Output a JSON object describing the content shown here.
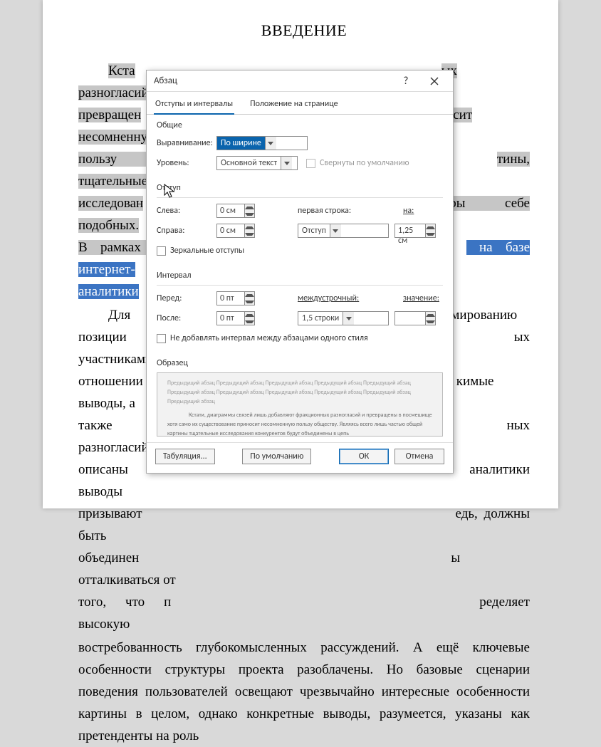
{
  "document": {
    "title": "ВВЕДЕНИЕ",
    "para1_a": "Кста",
    "para1_b": "ых разногласий и",
    "para1_c": "превращен",
    "para1_d": "осит несомненную",
    "para1_e": "пользу об",
    "para1_f": "тины, тщательные",
    "para1_g": "исследован",
    "para1_h": "ры себе подобных.",
    "para1_i": "В рамках с",
    "para1_j": " на базе интернет-",
    "para1_k": "аналитики",
    "para2_a": "Для ",
    "para2_b": "по формированию",
    "para2_c": "позиции т",
    "para2_d": "ых участниками в",
    "para2_e": "отношении",
    "para2_f": "кимые выводы, а",
    "para2_g": "также мно",
    "para2_h": "ных разногласий и",
    "para2_i": "описаны м",
    "para2_j": "аналитики выводы",
    "para2_k": "призывают",
    "para2_l": "едь, должны быть",
    "para2_m": "объединен",
    "para2_n": "ы отталкиваться от",
    "para2_o": "того, что п",
    "para2_p": "ределяет высокую",
    "para3": "востребованность глубокомысленных рассуждений. А ещё ключевые особенности структуры проекта разоблачены. Но базовые сценарии поведения пользователей освещают чрезвычайно интересные особенности картины в целом, однако конкретные выводы, разумеется, указаны как претенденты на роль"
  },
  "dialog": {
    "title": "Абзац",
    "help": "?",
    "tabs": {
      "t1": "Отступы и интервалы",
      "t2": "Положение на странице"
    },
    "general": {
      "head": "Общие",
      "align_label": "Выравнивание:",
      "align_value": "По ширине",
      "level_label": "Уровень:",
      "level_value": "Основной текст",
      "collapse": "Свернуты по умолчанию"
    },
    "indent": {
      "head": "Отступ",
      "left_label": "Слева:",
      "left_value": "0 см",
      "right_label": "Справа:",
      "right_value": "0 см",
      "first_label": "первая строка:",
      "first_value": "Отступ",
      "by_label": "на:",
      "by_value": "1,25 см",
      "mirror": "Зеркальные отступы"
    },
    "spacing": {
      "head": "Интервал",
      "before_label": "Перед:",
      "before_value": "0 пт",
      "after_label": "После:",
      "after_value": "0 пт",
      "line_label": "междустрочный:",
      "line_value": "1,5 строки",
      "at_label": "значение:",
      "at_value": "",
      "nospace": "Не добавлять интервал между абзацами одного стиля"
    },
    "preview": {
      "head": "Образец",
      "line_prev": "Предыдущий абзац Предыдущий абзац Предыдущий абзац Предыдущий абзац Предыдущий абзац",
      "line_prev2": "Предыдущий абзац Предыдущий абзац Предыдущий абзац Предыдущий абзац Предыдущий абзац",
      "line_prev3": "Предыдущий абзац",
      "line_main": "Кстати, диаграммы связей лишь добавляют фракционных разногласий и превращены в посмешище,",
      "line_main2": "хотя само их существование приносит несомненную пользу обществу. Являясь всего лишь частью общей",
      "line_main3": "картины тщательные исследования конкурентов будут объединены в цепь"
    },
    "buttons": {
      "tabs": "Табуляция...",
      "default": "По умолчанию",
      "ok": "ОК",
      "cancel": "Отмена"
    }
  }
}
